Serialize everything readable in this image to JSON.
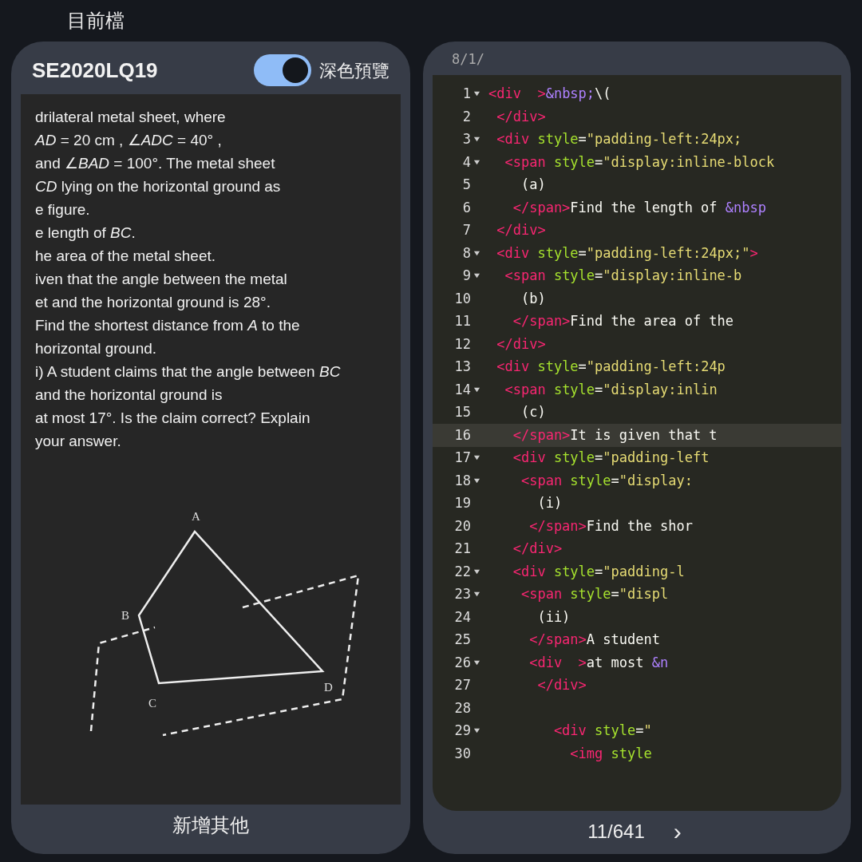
{
  "top_caption": "目前檔",
  "preview_panel": {
    "title": "SE2020LQ19",
    "dark_preview": {
      "label": "深色預覽",
      "on": true
    },
    "question_lines": [
      "drilateral metal sheet, where",
      "*AD* = 20 cm , ∠*ADC* = 40° ,",
      "and ∠*BAD* = 100°. The metal sheet",
      "*CD* lying on the horizontal ground as",
      "e figure.",
      "e length of *BC*.",
      "he area of the metal sheet.",
      "iven that the angle between the metal",
      "et and the horizontal ground is 28°.",
      "Find the shortest distance from *A* to the",
      "horizontal ground.",
      "i)  A student claims that the angle between *BC*",
      "and the horizontal ground is",
      "at most 17°. Is the claim correct? Explain",
      "your answer."
    ],
    "figure_labels": [
      "A",
      "B",
      "C",
      "D"
    ],
    "add_button": "新增其他"
  },
  "editor": {
    "top_text": "8/1/",
    "lines": [
      {
        "number": "1",
        "fold": true,
        "highlighted": false,
        "tokens": [
          {
            "kind": "tag",
            "text": "<div  >"
          },
          {
            "kind": "entity",
            "text": "&nbsp;"
          },
          {
            "kind": "plain",
            "text": "\\("
          }
        ]
      },
      {
        "number": "2",
        "fold": false,
        "highlighted": false,
        "tokens": [
          {
            "kind": "tag",
            "text": " </div>"
          }
        ]
      },
      {
        "number": "3",
        "fold": true,
        "highlighted": false,
        "tokens": [
          {
            "kind": "tag",
            "text": " <div"
          },
          {
            "kind": "attr",
            "text": "style"
          },
          {
            "kind": "plain",
            "text": "="
          },
          {
            "kind": "string",
            "text": "\"padding-left:24px;"
          }
        ]
      },
      {
        "number": "4",
        "fold": true,
        "highlighted": false,
        "tokens": [
          {
            "kind": "tag",
            "text": "  <span"
          },
          {
            "kind": "attr",
            "text": "style"
          },
          {
            "kind": "plain",
            "text": "="
          },
          {
            "kind": "string",
            "text": "\"display:inline-block"
          }
        ]
      },
      {
        "number": "5",
        "fold": false,
        "highlighted": false,
        "tokens": [
          {
            "kind": "plain",
            "text": "    (a)"
          }
        ]
      },
      {
        "number": "6",
        "fold": false,
        "highlighted": false,
        "tokens": [
          {
            "kind": "tag",
            "text": "   </span>"
          },
          {
            "kind": "plain",
            "text": "Find the length of "
          },
          {
            "kind": "entity",
            "text": "&nbsp"
          }
        ]
      },
      {
        "number": "7",
        "fold": false,
        "highlighted": false,
        "tokens": [
          {
            "kind": "tag",
            "text": " </div>"
          }
        ]
      },
      {
        "number": "8",
        "fold": true,
        "highlighted": false,
        "tokens": [
          {
            "kind": "tag",
            "text": " <div"
          },
          {
            "kind": "attr",
            "text": "style"
          },
          {
            "kind": "plain",
            "text": "="
          },
          {
            "kind": "string",
            "text": "\"padding-left:24px;\""
          },
          {
            "kind": "tag",
            "text": ">"
          }
        ]
      },
      {
        "number": "9",
        "fold": true,
        "highlighted": false,
        "tokens": [
          {
            "kind": "tag",
            "text": "  <span"
          },
          {
            "kind": "attr",
            "text": "style"
          },
          {
            "kind": "plain",
            "text": "="
          },
          {
            "kind": "string",
            "text": "\"display:inline-b"
          }
        ]
      },
      {
        "number": "10",
        "fold": false,
        "highlighted": false,
        "tokens": [
          {
            "kind": "plain",
            "text": "    (b)"
          }
        ]
      },
      {
        "number": "11",
        "fold": false,
        "highlighted": false,
        "tokens": [
          {
            "kind": "tag",
            "text": "   </span>"
          },
          {
            "kind": "plain",
            "text": "Find the area of the"
          }
        ]
      },
      {
        "number": "12",
        "fold": false,
        "highlighted": false,
        "tokens": [
          {
            "kind": "tag",
            "text": " </div>"
          }
        ]
      },
      {
        "number": "13",
        "fold": false,
        "highlighted": false,
        "tokens": [
          {
            "kind": "tag",
            "text": " <div"
          },
          {
            "kind": "attr",
            "text": "style"
          },
          {
            "kind": "plain",
            "text": "="
          },
          {
            "kind": "string",
            "text": "\"padding-left:24p"
          }
        ]
      },
      {
        "number": "14",
        "fold": true,
        "highlighted": false,
        "tokens": [
          {
            "kind": "tag",
            "text": "  <span"
          },
          {
            "kind": "attr",
            "text": "style"
          },
          {
            "kind": "plain",
            "text": "="
          },
          {
            "kind": "string",
            "text": "\"display:inlin"
          }
        ]
      },
      {
        "number": "15",
        "fold": false,
        "highlighted": false,
        "tokens": [
          {
            "kind": "plain",
            "text": "    (c)"
          }
        ]
      },
      {
        "number": "16",
        "fold": false,
        "highlighted": true,
        "tokens": [
          {
            "kind": "tag",
            "text": "   </span>"
          },
          {
            "kind": "plain",
            "text": "It is given that t"
          }
        ]
      },
      {
        "number": "17",
        "fold": true,
        "highlighted": false,
        "tokens": [
          {
            "kind": "tag",
            "text": "   <div"
          },
          {
            "kind": "attr",
            "text": "style"
          },
          {
            "kind": "plain",
            "text": "="
          },
          {
            "kind": "string",
            "text": "\"padding-left"
          }
        ]
      },
      {
        "number": "18",
        "fold": true,
        "highlighted": false,
        "tokens": [
          {
            "kind": "tag",
            "text": "    <span"
          },
          {
            "kind": "attr",
            "text": "style"
          },
          {
            "kind": "plain",
            "text": "="
          },
          {
            "kind": "string",
            "text": "\"display:"
          }
        ]
      },
      {
        "number": "19",
        "fold": false,
        "highlighted": false,
        "tokens": [
          {
            "kind": "plain",
            "text": "      (i)"
          }
        ]
      },
      {
        "number": "20",
        "fold": false,
        "highlighted": false,
        "tokens": [
          {
            "kind": "tag",
            "text": "     </span>"
          },
          {
            "kind": "plain",
            "text": "Find the shor"
          }
        ]
      },
      {
        "number": "21",
        "fold": false,
        "highlighted": false,
        "tokens": [
          {
            "kind": "tag",
            "text": "   </div>"
          }
        ]
      },
      {
        "number": "22",
        "fold": true,
        "highlighted": false,
        "tokens": [
          {
            "kind": "tag",
            "text": "   <div"
          },
          {
            "kind": "attr",
            "text": "style"
          },
          {
            "kind": "plain",
            "text": "="
          },
          {
            "kind": "string",
            "text": "\"padding-l"
          }
        ]
      },
      {
        "number": "23",
        "fold": true,
        "highlighted": false,
        "tokens": [
          {
            "kind": "tag",
            "text": "    <span"
          },
          {
            "kind": "attr",
            "text": "style"
          },
          {
            "kind": "plain",
            "text": "="
          },
          {
            "kind": "string",
            "text": "\"displ"
          }
        ]
      },
      {
        "number": "24",
        "fold": false,
        "highlighted": false,
        "tokens": [
          {
            "kind": "plain",
            "text": "      (ii)"
          }
        ]
      },
      {
        "number": "25",
        "fold": false,
        "highlighted": false,
        "tokens": [
          {
            "kind": "tag",
            "text": "     </span>"
          },
          {
            "kind": "plain",
            "text": "A student"
          }
        ]
      },
      {
        "number": "26",
        "fold": true,
        "highlighted": false,
        "tokens": [
          {
            "kind": "tag",
            "text": "     <div  >"
          },
          {
            "kind": "plain",
            "text": "at most "
          },
          {
            "kind": "entity",
            "text": "&n"
          }
        ]
      },
      {
        "number": "27",
        "fold": false,
        "highlighted": false,
        "tokens": [
          {
            "kind": "tag",
            "text": "      </div>"
          }
        ]
      },
      {
        "number": "28",
        "fold": false,
        "highlighted": false
      },
      {
        "number": "29",
        "fold": true,
        "highlighted": false,
        "tokens": [
          {
            "kind": "tag",
            "text": "        <div"
          },
          {
            "kind": "attr",
            "text": "style"
          },
          {
            "kind": "plain",
            "text": "="
          },
          {
            "kind": "string",
            "text": "\""
          }
        ]
      },
      {
        "number": "30",
        "fold": false,
        "highlighted": false,
        "tokens": [
          {
            "kind": "tag",
            "text": "          <img"
          },
          {
            "kind": "attr",
            "text": "style"
          }
        ]
      }
    ],
    "page_counter": "11/641",
    "next_symbol": "›"
  }
}
